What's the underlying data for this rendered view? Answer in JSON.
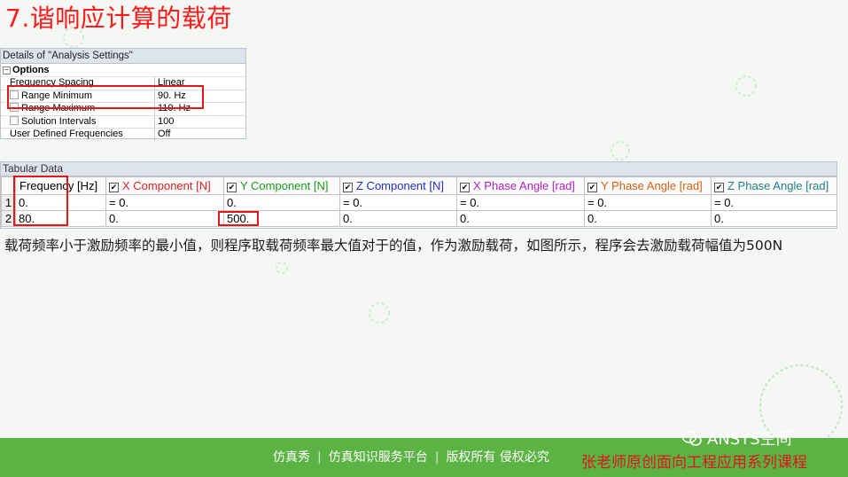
{
  "slide": {
    "title": "7.谐响应计算的载荷"
  },
  "details": {
    "header": "Details of \"Analysis Settings\"",
    "group_label": "Options",
    "group_toggle": "−",
    "rows": [
      {
        "key": "Frequency Spacing",
        "value": "Linear"
      },
      {
        "key": "Range Minimum",
        "value": "90. Hz"
      },
      {
        "key": "Range Maximum",
        "value": "110. Hz"
      },
      {
        "key": "Solution Intervals",
        "value": "100"
      },
      {
        "key": "User Defined Frequencies",
        "value": "Off"
      }
    ]
  },
  "tabular": {
    "header": "Tabular Data",
    "columns": [
      {
        "label": "Frequency [Hz]",
        "color": "#000000"
      },
      {
        "label": "X Component [N]",
        "color": "#e02020"
      },
      {
        "label": "Y Component [N]",
        "color": "#1a9a1a"
      },
      {
        "label": "Z Component [N]",
        "color": "#2030c0"
      },
      {
        "label": "X Phase Angle [rad]",
        "color": "#b020c0"
      },
      {
        "label": "Y Phase Angle [rad]",
        "color": "#d06010"
      },
      {
        "label": "Z Phase Angle [rad]",
        "color": "#208080"
      }
    ],
    "rows": [
      {
        "n": "1",
        "cells": [
          "0.",
          "= 0.",
          "0.",
          "= 0.",
          "= 0.",
          "= 0.",
          "= 0."
        ]
      },
      {
        "n": "2",
        "cells": [
          "80.",
          "0.",
          "500.",
          "0.",
          "0.",
          "0.",
          "0."
        ]
      }
    ]
  },
  "body_text": "载荷频率小于激励频率的最小值，则程序取载荷频率最大值对于的值，作为激励载荷，如图所示，程序会去激励载荷幅值为500N",
  "footer": {
    "links": [
      "仿真秀",
      "仿真知识服务平台",
      "版权所有 侵权必究"
    ],
    "separator": "|",
    "brand": "ANSYS空间",
    "course": "张老师原创面向工程应用系列课程"
  }
}
